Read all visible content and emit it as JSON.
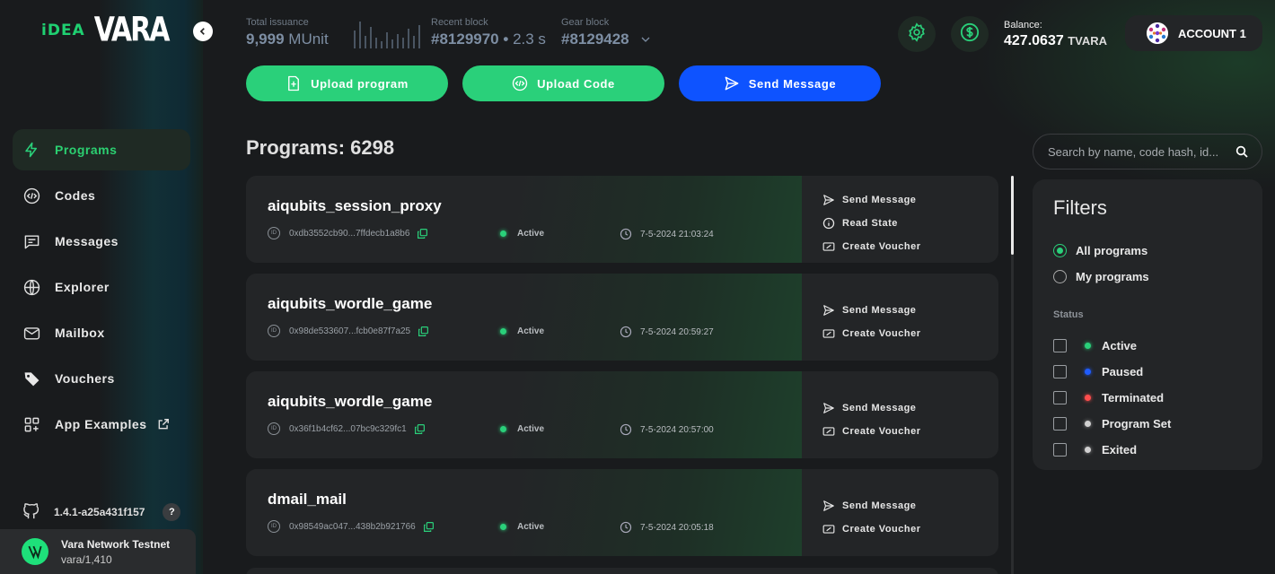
{
  "header": {
    "total_issuance": {
      "label": "Total issuance",
      "value": "9,999",
      "unit": "MUnit"
    },
    "recent_block": {
      "label": "Recent block",
      "value": "#8129970",
      "time": "2.3 s"
    },
    "gear_block": {
      "label": "Gear block",
      "value": "#8129428"
    },
    "balance": {
      "label": "Balance:",
      "value": "427.0637",
      "unit": "TVARA"
    },
    "account": {
      "label": "ACCOUNT 1"
    }
  },
  "logo": {
    "idea": "iDEA",
    "vara": "VARA"
  },
  "sidebar": {
    "items": [
      {
        "label": "Programs",
        "icon": "lightning-icon",
        "active": true
      },
      {
        "label": "Codes",
        "icon": "code-icon"
      },
      {
        "label": "Messages",
        "icon": "message-icon"
      },
      {
        "label": "Explorer",
        "icon": "globe-icon"
      },
      {
        "label": "Mailbox",
        "icon": "mail-icon"
      },
      {
        "label": "Vouchers",
        "icon": "tag-icon"
      },
      {
        "label": "App Examples",
        "icon": "apps-icon"
      }
    ],
    "version": "1.4.1-a25a431f157",
    "help": "?",
    "network": {
      "name": "Vara Network Testnet",
      "sub": "vara/1,410"
    }
  },
  "actions": {
    "upload_program": "Upload program",
    "upload_code": "Upload Code",
    "send_message": "Send Message"
  },
  "colors": {
    "accent_green": "#2ad07a",
    "accent_blue": "#0e53ff",
    "status_active": "#2ad07a",
    "status_paused": "#1f5cff",
    "status_terminated": "#ff4d4d",
    "status_neutral": "#d0d0d0"
  },
  "main": {
    "title": "Programs: 6298",
    "search_placeholder": "Search by name, code hash, id...",
    "programs": [
      {
        "name": "aiqubits_session_proxy",
        "id": "0xdb3552cb90...7ffdecb1a8b6",
        "status": "Active",
        "time": "7-5-2024 21:03:24",
        "actions": [
          "Send Message",
          "Read State",
          "Create Voucher"
        ]
      },
      {
        "name": "aiqubits_wordle_game",
        "id": "0x98de533607...fcb0e87f7a25",
        "status": "Active",
        "time": "7-5-2024 20:59:27",
        "actions": [
          "Send Message",
          "Create Voucher"
        ]
      },
      {
        "name": "aiqubits_wordle_game",
        "id": "0x36f1b4cf62...07bc9c329fc1",
        "status": "Active",
        "time": "7-5-2024 20:57:00",
        "actions": [
          "Send Message",
          "Create Voucher"
        ]
      },
      {
        "name": "dmail_mail",
        "id": "0x98549ac047...438b2b921766",
        "status": "Active",
        "time": "7-5-2024 20:05:18",
        "actions": [
          "Send Message",
          "Create Voucher"
        ]
      }
    ]
  },
  "filters": {
    "title": "Filters",
    "scope": [
      {
        "label": "All programs",
        "selected": true
      },
      {
        "label": "My programs",
        "selected": false
      }
    ],
    "status_label": "Status",
    "status": [
      {
        "label": "Active",
        "color": "#2ad07a"
      },
      {
        "label": "Paused",
        "color": "#1f5cff"
      },
      {
        "label": "Terminated",
        "color": "#ff4d4d"
      },
      {
        "label": "Program Set",
        "color": "#d0d0d0"
      },
      {
        "label": "Exited",
        "color": "#d0d0d0"
      }
    ]
  }
}
